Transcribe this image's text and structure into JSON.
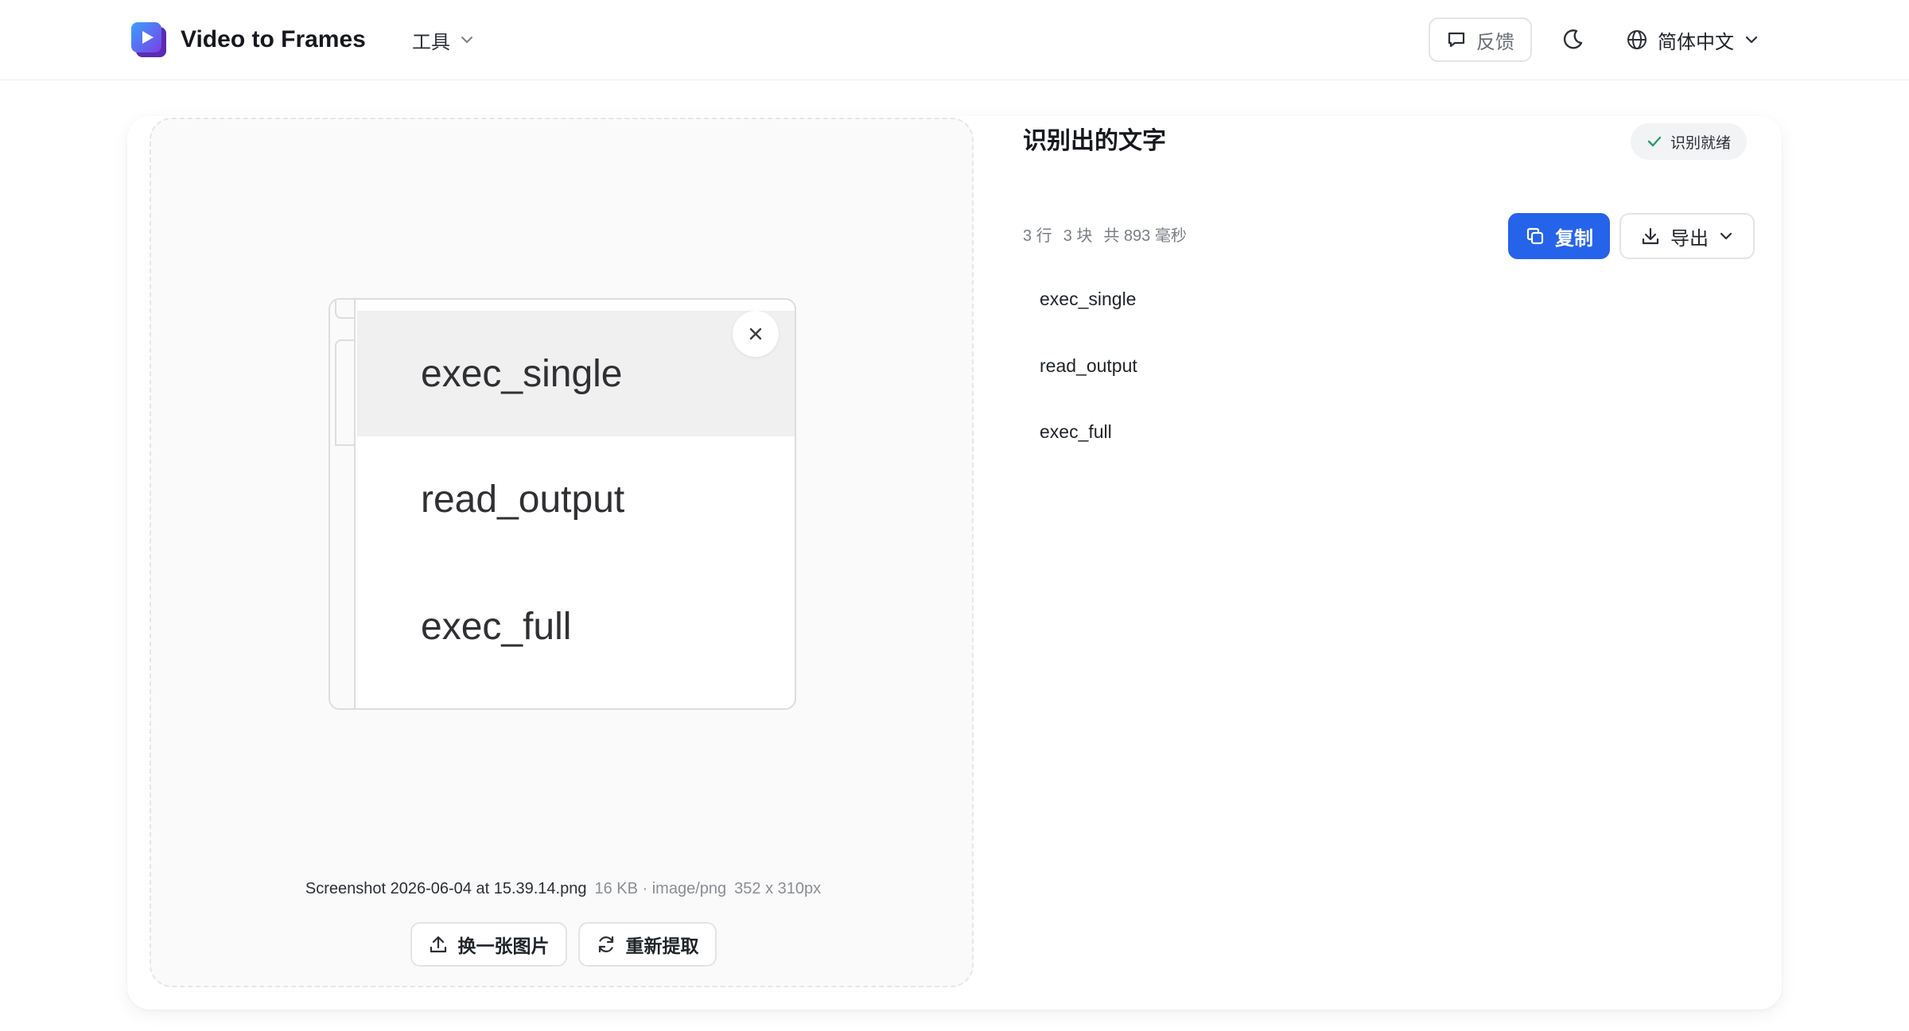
{
  "header": {
    "brand": "Video to Frames",
    "tools_label": "工具",
    "feedback_label": "反馈",
    "language_label": "简体中文"
  },
  "preview": {
    "image_rows": [
      "exec_single",
      "read_output",
      "exec_full"
    ],
    "file_name": "Screenshot 2026-06-04 at 15.39.14.png",
    "file_meta": "16 KB · image/png",
    "file_dims": "352 x 310px",
    "replace_label": "换一张图片",
    "reextract_label": "重新提取"
  },
  "result": {
    "title": "识别出的文字",
    "status_badge": "识别就绪",
    "stat_lines": "3 行",
    "stat_blocks": "3 块",
    "stat_time": "共 893 毫秒",
    "copy_label": "复制",
    "export_label": "导出",
    "lines": [
      "exec_single",
      "read_output",
      "exec_full"
    ]
  },
  "colors": {
    "accent": "#2563eb",
    "check": "#22a06b"
  }
}
